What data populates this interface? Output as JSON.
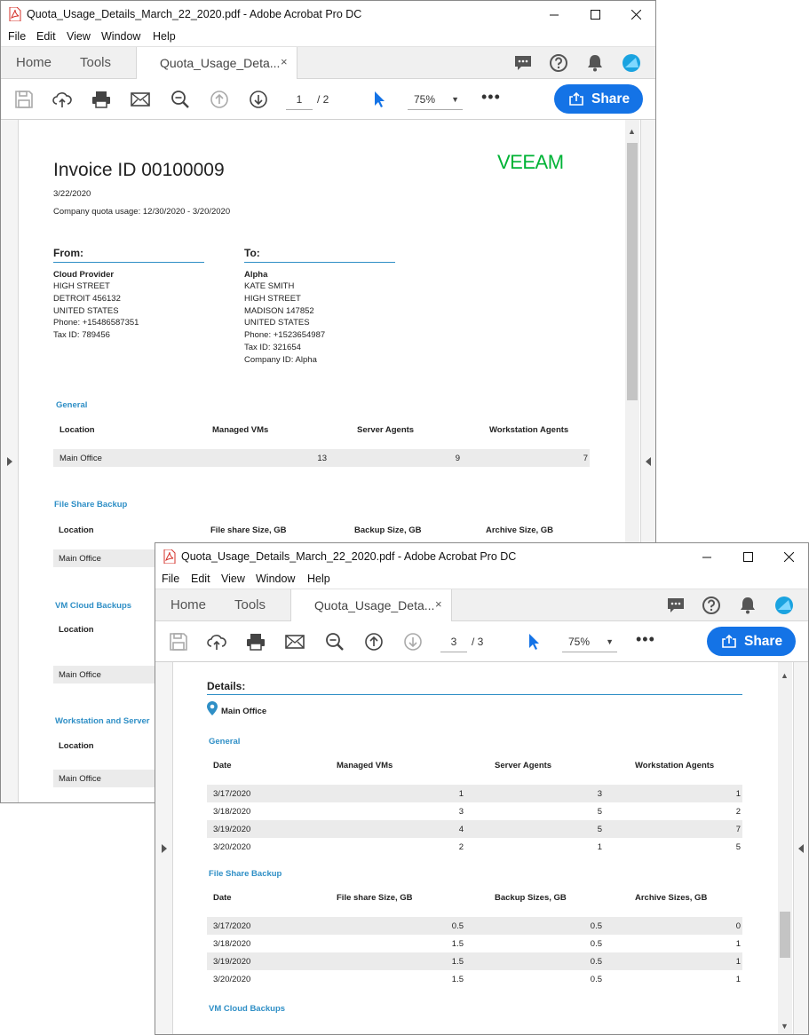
{
  "colors": {
    "accent": "#1473e6",
    "section": "#2f8fc6",
    "logo": "#00b336"
  },
  "window1": {
    "title": "Quota_Usage_Details_March_22_2020.pdf - Adobe Acrobat Pro DC",
    "menu": [
      "File",
      "Edit",
      "View",
      "Window",
      "Help"
    ],
    "tabs": {
      "home": "Home",
      "tools": "Tools",
      "doc": "Quota_Usage_Deta...",
      "close": "×"
    },
    "page_current": "1",
    "page_total": "/ 2",
    "zoom": "75%",
    "more": "•••",
    "share": "Share",
    "doc": {
      "logo": "VEEAM",
      "invoice_title": "Invoice ID 00100009",
      "date": "3/22/2020",
      "quota_usage": "Company quota usage: 12/30/2020 - 3/20/2020",
      "from_label": "From:",
      "to_label": "To:",
      "from": {
        "name": "Cloud Provider",
        "lines": [
          "HIGH STREET",
          "DETROIT 456132",
          "UNITED STATES",
          "Phone: +15486587351",
          "Tax ID: 789456"
        ]
      },
      "to": {
        "name": "Alpha",
        "lines": [
          "KATE SMITH",
          "HIGH STREET",
          "MADISON 147852",
          "UNITED STATES",
          "Phone: +1523654987",
          "Tax ID: 321654",
          "Company ID: Alpha"
        ]
      },
      "general": {
        "title": "General",
        "headers": [
          "Location",
          "Managed VMs",
          "Server Agents",
          "Workstation Agents"
        ],
        "row": {
          "location": "Main Office",
          "vms": "13",
          "server": "9",
          "workstation": "7"
        }
      },
      "file_share": {
        "title": "File Share Backup",
        "headers": [
          "Location",
          "File share Size, GB",
          "Backup Size, GB",
          "Archive Size, GB"
        ],
        "row_location": "Main Office"
      },
      "vm_cloud": {
        "title": "VM Cloud Backups",
        "header": "Location",
        "row_location": "Main Office"
      },
      "workstation_server": {
        "title": "Workstation and Server",
        "header": "Location",
        "row_location": "Main Office"
      }
    }
  },
  "window2": {
    "title": "Quota_Usage_Details_March_22_2020.pdf - Adobe Acrobat Pro DC",
    "menu": [
      "File",
      "Edit",
      "View",
      "Window",
      "Help"
    ],
    "tabs": {
      "home": "Home",
      "tools": "Tools",
      "doc": "Quota_Usage_Deta...",
      "close": "×"
    },
    "page_current": "3",
    "page_total": "/ 3",
    "zoom": "75%",
    "more": "•••",
    "share": "Share",
    "doc": {
      "details_label": "Details:",
      "location": "Main Office",
      "general": {
        "title": "General",
        "headers": [
          "Date",
          "Managed VMs",
          "Server Agents",
          "Workstation Agents"
        ],
        "rows": [
          [
            "3/17/2020",
            "1",
            "3",
            "1"
          ],
          [
            "3/18/2020",
            "3",
            "5",
            "2"
          ],
          [
            "3/19/2020",
            "4",
            "5",
            "7"
          ],
          [
            "3/20/2020",
            "2",
            "1",
            "5"
          ]
        ]
      },
      "file_share": {
        "title": "File Share Backup",
        "headers": [
          "Date",
          "File share Size, GB",
          "Backup Sizes, GB",
          "Archive Sizes, GB"
        ],
        "rows": [
          [
            "3/17/2020",
            "0.5",
            "0.5",
            "0"
          ],
          [
            "3/18/2020",
            "1.5",
            "0.5",
            "1"
          ],
          [
            "3/19/2020",
            "1.5",
            "0.5",
            "1"
          ],
          [
            "3/20/2020",
            "1.5",
            "0.5",
            "1"
          ]
        ]
      },
      "vm_cloud_title": "VM Cloud Backups"
    }
  }
}
